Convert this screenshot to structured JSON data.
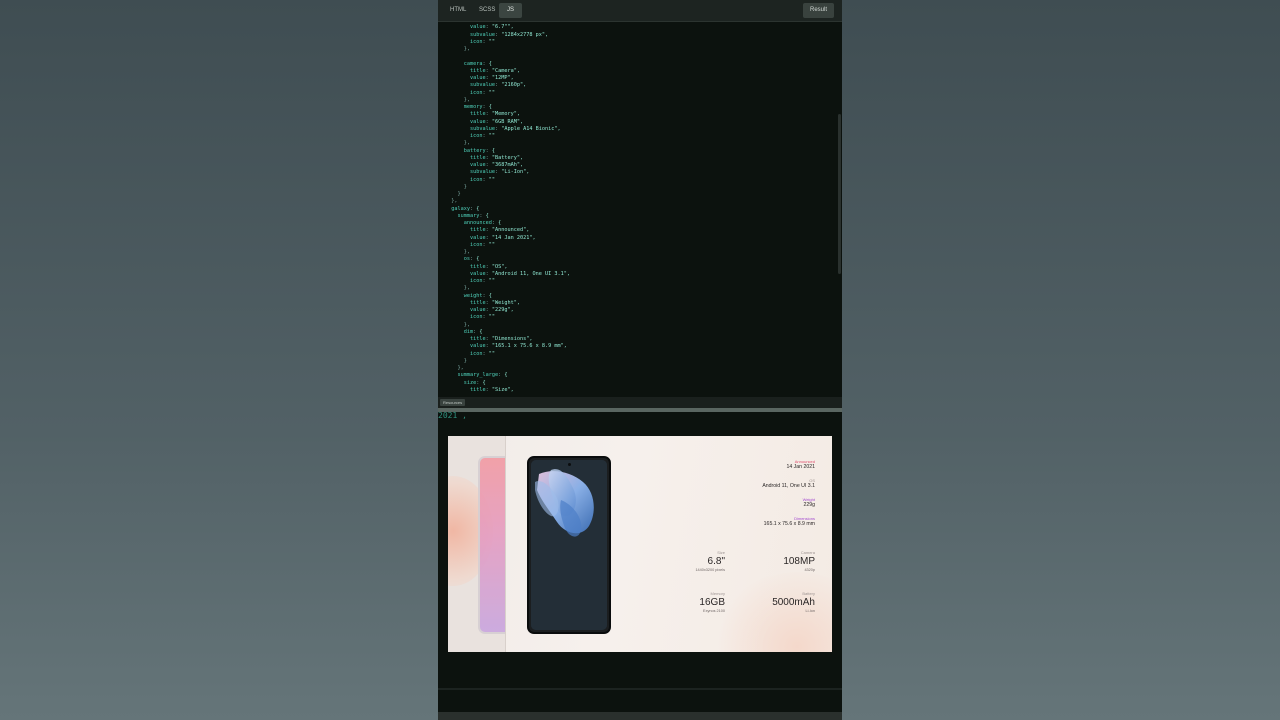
{
  "editor": {
    "tabs": [
      "HTML",
      "SCSS",
      "JS"
    ],
    "active_tab": "JS",
    "result_button": "Result",
    "resources_button": "Resources",
    "code_lines": [
      "        title: \"Size\",",
      "        value: \"6.7\"\",",
      "        subvalue: \"1284x2778 px\",",
      "        icon: \"\"",
      "      },",
      "",
      "      camera: {",
      "        title: \"Camera\",",
      "        value: \"12MP\",",
      "        subvalue: \"2160p\",",
      "        icon: \"\"",
      "      },",
      "      memory: {",
      "        title: \"Memory\",",
      "        value: \"6GB RAM\",",
      "        subvalue: \"Apple A14 Bionic\",",
      "        icon: \"\"",
      "      },",
      "      battery: {",
      "        title: \"Battery\",",
      "        value: \"3687mAh\",",
      "        subvalue: \"Li-Ion\",",
      "        icon: \"\"",
      "      }",
      "    }",
      "  },",
      "  galaxy: {",
      "    summary: {",
      "      announced: {",
      "        title: \"Announced\",",
      "        value: \"14 Jan 2021\",",
      "        icon: \"\"",
      "      },",
      "      os: {",
      "        title: \"OS\",",
      "        value: \"Android 11, One UI 3.1\",",
      "        icon: \"\"",
      "      },",
      "      weight: {",
      "        title: \"Weight\",",
      "        value: \"229g\",",
      "        icon: \"\"",
      "      },",
      "      dim: {",
      "        title: \"Dimensions\",",
      "        value: \"165.1 x 75.6 x 8.9 mm\",",
      "        icon: \"\"",
      "      }",
      "    },",
      "    summary_large: {",
      "      size: {",
      "        title: \"Size\","
    ]
  },
  "result": {
    "background_text": "2021 ,",
    "specs": {
      "announced": {
        "title": "Announced",
        "value": "14 Jan 2021"
      },
      "os": {
        "title": "OS",
        "value": "Android 11, One UI 3.1"
      },
      "weight": {
        "title": "Weight",
        "value": "229g"
      },
      "dimensions": {
        "title": "Dimensions",
        "value": "165.1 x 75.6 x 8.9 mm"
      },
      "size": {
        "title": "Size",
        "value": "6.8\"",
        "subvalue": "1440x3200 pixels"
      },
      "camera": {
        "title": "Camera",
        "value": "108MP",
        "subvalue": "4320p"
      },
      "memory": {
        "title": "Memory",
        "value": "16GB",
        "subvalue": "Exynos 2100"
      },
      "battery": {
        "title": "Battery",
        "value": "5000mAh",
        "subvalue": "Li-Ion"
      }
    }
  },
  "colors": {
    "accent_pink": "#e04f6e",
    "accent_purple": "#a24ad0",
    "code_teal": "#3cc6b5"
  }
}
